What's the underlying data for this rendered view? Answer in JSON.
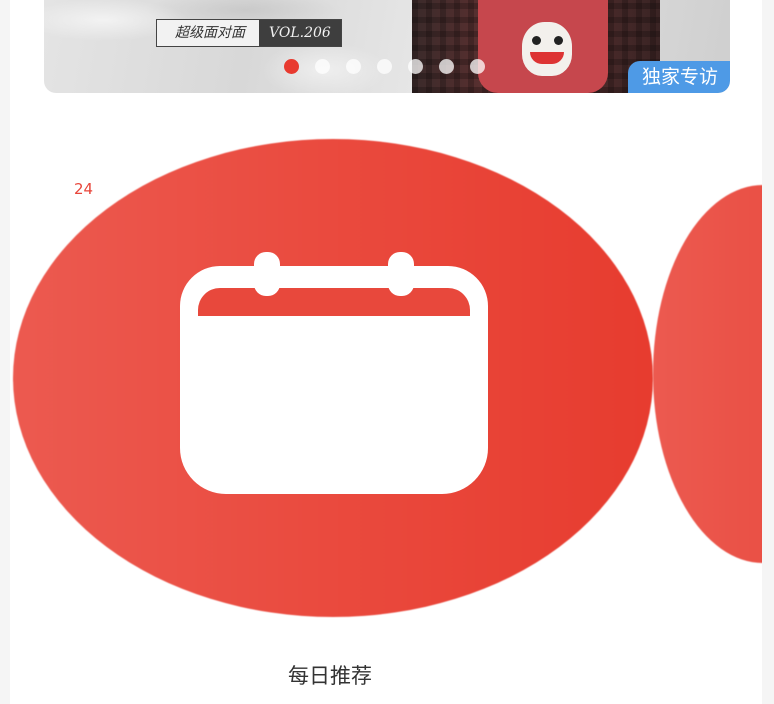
{
  "banner": {
    "vol_series": "超级面对面",
    "vol_number": "VOL.206",
    "badge": "独家专访",
    "dots_count": 7,
    "active_dot_index": 0
  },
  "card": {
    "counter": "24",
    "icon": "calendar-icon",
    "label": "每日推荐"
  },
  "colors": {
    "accent_red": "#e8453a",
    "badge_blue": "#4e9ae6",
    "text": "#333333"
  }
}
